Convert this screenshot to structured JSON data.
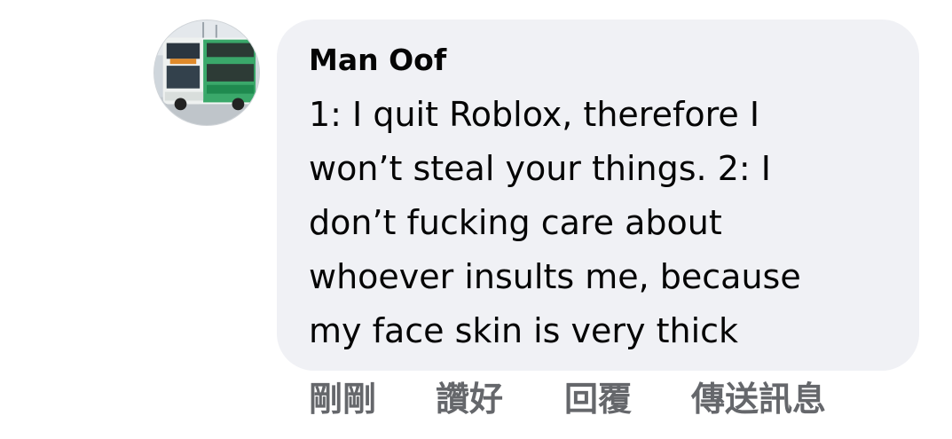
{
  "comment": {
    "author": "Man Oof",
    "text": "1: I quit Roblox, therefore I\nwon’t steal your things. 2: I\ndon’t fucking care about\nwhoever insults me, because\nmy face skin is very thick",
    "avatar_icon": "bus-avatar-icon"
  },
  "actions": {
    "timestamp": "剛剛",
    "like_label": "讚好",
    "reply_label": "回覆",
    "message_label": "傳送訊息"
  },
  "colors": {
    "bubble": "#f0f1f5",
    "text": "#050505",
    "action_text": "#65676b"
  }
}
